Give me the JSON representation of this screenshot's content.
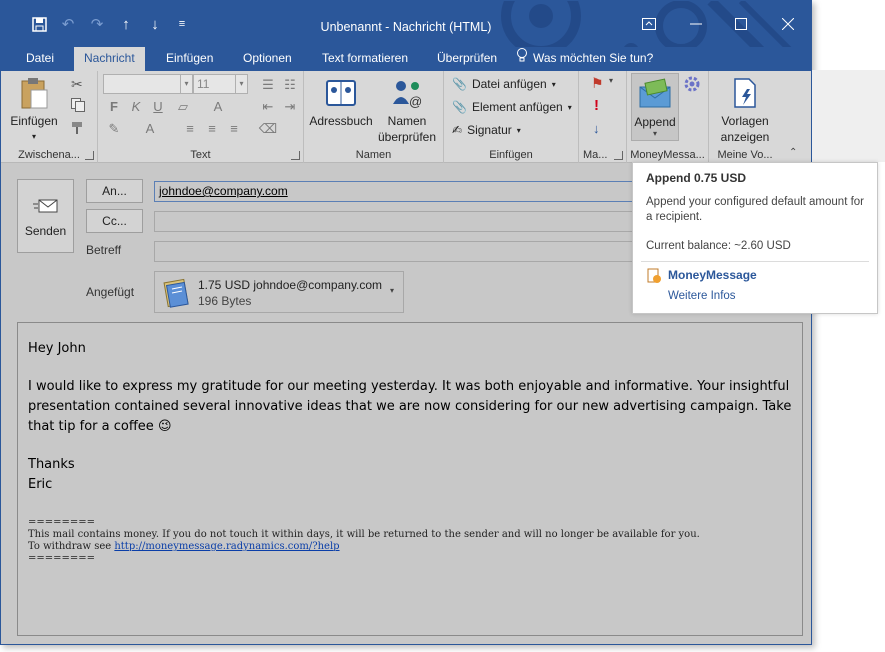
{
  "window": {
    "title": "Unbenannt - Nachricht (HTML)",
    "qat": {
      "undo_icon": "undo-icon",
      "redo_icon": "redo-icon",
      "more_glyph": "≡"
    }
  },
  "tabs": [
    "Datei",
    "Nachricht",
    "Einfügen",
    "Optionen",
    "Text formatieren",
    "Überprüfen"
  ],
  "active_tab": "Nachricht",
  "tell_me": "Was möchten Sie tun?",
  "ribbon": {
    "clipboard": {
      "paste_label": "Einfügen",
      "group_label": "Zwischena..."
    },
    "text": {
      "font_name": "",
      "font_size": "11",
      "group_label": "Text",
      "bold": "F",
      "italic": "K",
      "underline": "U"
    },
    "names": {
      "address_book": "Adressbuch",
      "check_names_line1": "Namen",
      "check_names_line2": "überprüfen",
      "group_label": "Namen"
    },
    "include": {
      "attach_file": "Datei anfügen",
      "attach_item": "Element anfügen",
      "signature": "Signatur",
      "group_label": "Einfügen"
    },
    "tags": {
      "group_label": "Ma..."
    },
    "moneymessage": {
      "append_label": "Append",
      "group_label": "MoneyMessa..."
    },
    "templates": {
      "line1": "Vorlagen",
      "line2": "anzeigen",
      "group_label": "Meine Vo..."
    }
  },
  "compose": {
    "send_label": "Senden",
    "to_button": "An...",
    "cc_button": "Cc...",
    "subject_label": "Betreff",
    "to_value": "johndoe@company.com",
    "cc_value": "",
    "subject_value": "",
    "attached_label": "Angefügt",
    "attachment": {
      "name": "1.75 USD johndoe@company.com",
      "size": "196 Bytes"
    },
    "body": {
      "greeting": "Hey John",
      "paragraph": "I would like to express my gratitude for our meeting yesterday. It was both enjoyable and informative. Your insightful presentation contained several innovative ideas that we are now considering for our new advertising campaign. Take that tip for a coffee",
      "emoji": "😉",
      "closing": "Thanks",
      "signature_name": "Eric",
      "sep1": "========",
      "money_note": "This mail contains money. If you do not touch it within days, it will be returned to the sender and will no longer be available for you.",
      "withdraw_prefix": "To withdraw see ",
      "withdraw_link": "http://moneymessage.radynamics.com/?help",
      "sep2": "========"
    }
  },
  "tooltip": {
    "title": "Append 0.75 USD",
    "description": "Append your configured default amount for a recipient.",
    "balance": "Current balance: ~2.60 USD",
    "addin_name": "MoneyMessage",
    "more_info": "Weitere Infos"
  },
  "colors": {
    "accent": "#2b579a",
    "ribbon_bg": "#d8d8d8",
    "compose_bg": "#c8c8c8"
  }
}
